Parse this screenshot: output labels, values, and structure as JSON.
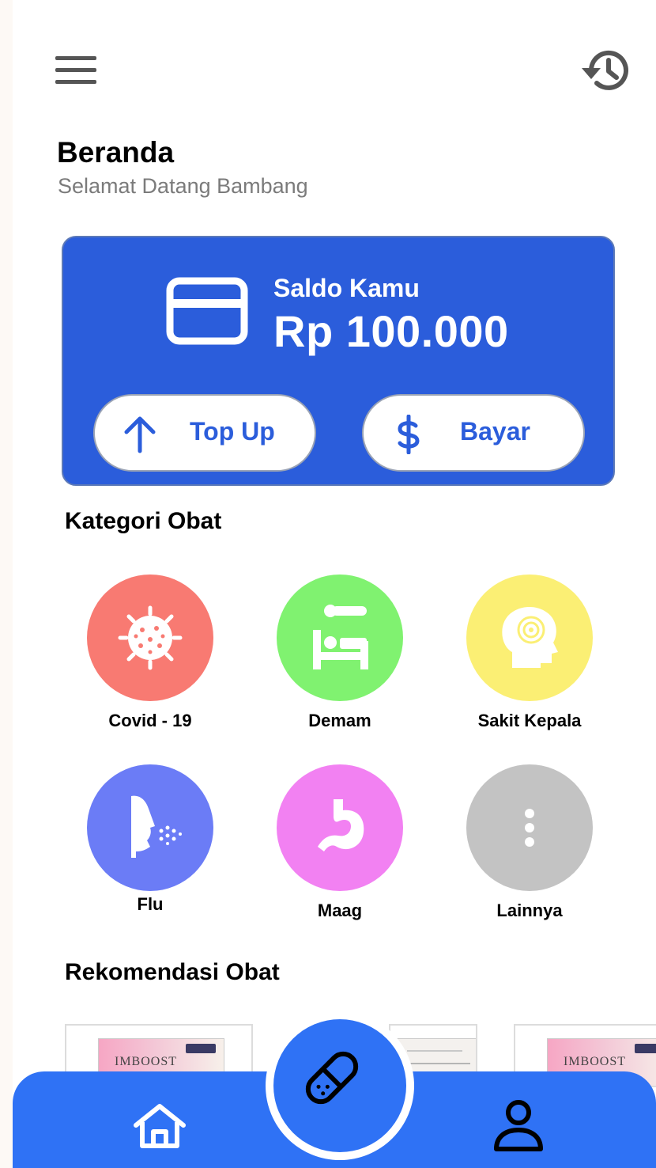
{
  "header": {
    "menu_icon": "hamburger-menu-icon",
    "history_icon": "history-icon"
  },
  "page": {
    "title": "Beranda",
    "subtitle": "Selamat Datang Bambang"
  },
  "balance_card": {
    "label": "Saldo Kamu",
    "value": "Rp 100.000",
    "icon": "credit-card-icon",
    "topup_label": "Top Up",
    "topup_icon": "arrow-up-icon",
    "pay_label": "Bayar",
    "pay_icon": "dollar-icon"
  },
  "categories": {
    "title": "Kategori Obat",
    "items": [
      {
        "label": "Covid - 19",
        "icon": "virus-icon",
        "color": "#f87a72"
      },
      {
        "label": "Demam",
        "icon": "fever-bed-icon",
        "color": "#80f270"
      },
      {
        "label": "Sakit Kepala",
        "icon": "headache-icon",
        "color": "#fbef74"
      },
      {
        "label": "Flu",
        "icon": "sneeze-icon",
        "color": "#6b7cf6"
      },
      {
        "label": "Maag",
        "icon": "stomach-icon",
        "color": "#f281f2"
      },
      {
        "label": "Lainnya",
        "icon": "more-vertical-icon",
        "color": "#c3c3c3"
      }
    ]
  },
  "recommendations": {
    "title": "Rekomendasi Obat",
    "items": [
      {
        "brand": "IMBOOST"
      },
      {
        "brand": ""
      },
      {
        "brand": "IMBOOST"
      }
    ]
  },
  "bottom_nav": {
    "home_icon": "home-icon",
    "center_icon": "pill-capsule-icon",
    "profile_icon": "user-icon",
    "bar_color": "#2f72f5"
  },
  "colors": {
    "primary": "#2b5ddb",
    "nav": "#2f72f5"
  }
}
